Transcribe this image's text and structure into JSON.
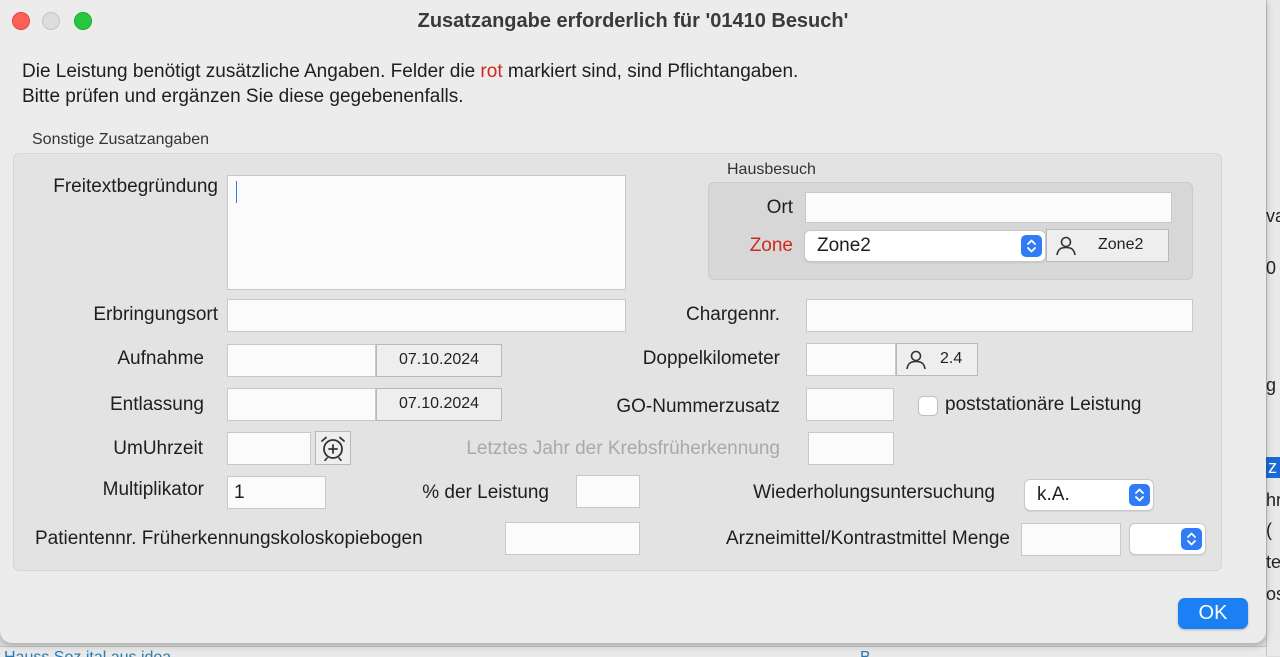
{
  "window": {
    "title": "Zusatzangabe erforderlich für '01410 Besuch'"
  },
  "info": {
    "line1_before": "Die Leistung benötigt zusätzliche Angaben. Felder die ",
    "line1_red": "rot",
    "line1_after": " markiert sind, sind Pflichtangaben.",
    "line2": "Bitte prüfen und ergänzen Sie diese gegebenenfalls."
  },
  "group_title": "Sonstige Zusatzangaben",
  "fields": {
    "freitext_label": "Freitextbegründung",
    "freitext_value": "",
    "erbringungsort_label": "Erbringungsort",
    "erbringungsort_value": "",
    "aufnahme_label": "Aufnahme",
    "aufnahme_value": "",
    "aufnahme_date": "07.10.2024",
    "entlassung_label": "Entlassung",
    "entlassung_value": "",
    "entlassung_date": "07.10.2024",
    "umuhrzeit_label": "UmUhrzeit",
    "umuhrzeit_value": "",
    "multiplikator_label": "Multiplikator",
    "multiplikator_value": "1",
    "prozent_label": "% der Leistung",
    "prozent_value": "",
    "patientennr_label": "Patientennr. Früherkennungskoloskopiebogen",
    "patientennr_value": "",
    "chargennr_label": "Chargennr.",
    "chargennr_value": "",
    "doppelkilometer_label": "Doppelkilometer",
    "doppelkilometer_value": "",
    "doppelkilometer_lookup": "2.4",
    "gonummer_label": "GO-Nummerzusatz",
    "gonummer_value": "",
    "poststationaer_label": "poststationäre Leistung",
    "poststationaer_checked": false,
    "krebs_label": "Letztes Jahr der Krebsfrüherkennung",
    "krebs_value": "",
    "wiederholung_label": "Wiederholungsuntersuchung",
    "wiederholung_value": "k.A.",
    "arzneimittel_label": "Arzneimittel/Kontrastmittel Menge",
    "arzneimittel_value": "",
    "arzneimittel_unit": ""
  },
  "hausbesuch": {
    "title": "Hausbesuch",
    "ort_label": "Ort",
    "ort_value": "",
    "zone_label": "Zone",
    "zone_value": "Zone2",
    "zone_lookup": "Zone2"
  },
  "buttons": {
    "ok": "OK"
  },
  "icons": {
    "person": "person-icon",
    "alarm": "alarm-clock-icon",
    "stepper": "chevron-updown-icon"
  },
  "colors": {
    "required": "#d0281e",
    "accent": "#1a80f4",
    "close": "#fe5f57",
    "maximize": "#27c840"
  },
  "background": {
    "right_fragments": [
      "va",
      "0",
      "g",
      "z",
      "hr",
      "(",
      "te",
      "os"
    ],
    "bottom_text": "Hauss Soz ital aus idea",
    "bottom_text2": "B"
  }
}
